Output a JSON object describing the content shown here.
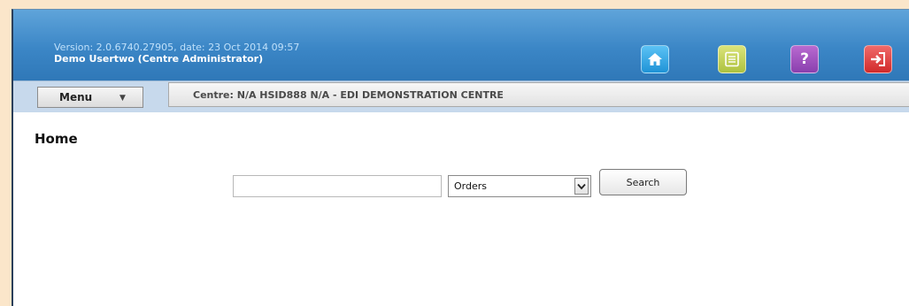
{
  "header": {
    "version_text": "Version: 2.0.6740.27905, date: 23 Oct 2014 09:57",
    "user_text": "Demo Usertwo (Centre Administrator)",
    "help_label": "?"
  },
  "nav": {
    "menu_label": "Menu",
    "menu_arrow": "▼",
    "centre_text": "Centre: N/A HSID888 N/A - EDI DEMONSTRATION CENTRE"
  },
  "page": {
    "title": "Home"
  },
  "search": {
    "input_value": "",
    "select_value": "Orders",
    "button_label": "Search"
  },
  "colors": {
    "header": "#3b86c6",
    "navbar": "#c7d9ec",
    "home_button": "#1f93d6",
    "doc_button": "#adc23f",
    "help_button": "#8a3fae",
    "exit_button": "#d12a2a",
    "page_background": "#fbe6ca"
  },
  "icons": {
    "home": "home-icon",
    "document": "document-icon",
    "help": "help-icon",
    "logout": "logout-icon",
    "select": "chevron-down-icon"
  }
}
